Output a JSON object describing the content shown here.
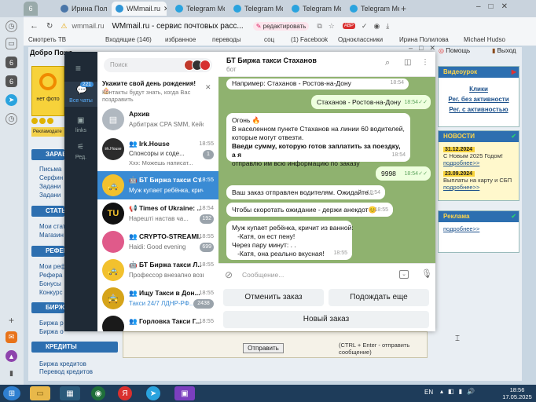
{
  "browser": {
    "tabs": [
      {
        "label": "6",
        "color": "#666"
      },
      {
        "label": "Ирина Поли",
        "color": "#4a76a8"
      },
      {
        "label": "WMmail.ru",
        "color": "#2f95d6"
      },
      {
        "label": "Telegram Me",
        "color": "#2aa3de"
      },
      {
        "label": "Telegram Me",
        "color": "#2aa3de"
      },
      {
        "label": "Telegram Me",
        "color": "#2aa3de"
      },
      {
        "label": "Telegram Me",
        "color": "#2aa3de"
      }
    ],
    "url": "wmmail.ru",
    "page_title": "WMmail.ru - сервис почтовых расс...",
    "edit_label": "редактировать",
    "bookmarks": [
      "Смотреть ТВ",
      "Входящие (146)",
      "избранное",
      "переводы",
      "соц",
      "(1) Facebook",
      "Одноклассники",
      "Ирина Полилова",
      "Michael Hudso"
    ],
    "extra_buttons": {
      "help": "Помощь",
      "exit": "Выход"
    }
  },
  "site": {
    "welcome": "Добро Пожа",
    "no_photo": "нет фото",
    "advert_text": "Рекламодате",
    "sections": [
      {
        "title": "ЗАРАБ",
        "links": [
          "Письма",
          "Серфин",
          "Задани",
          "Задани"
        ]
      },
      {
        "title": "СТАТЬ",
        "links": [
          "Мои стат",
          "Магазин"
        ]
      },
      {
        "title": "РЕФЕР",
        "links": [
          "Мои реф",
          "Рефера",
          "Бонусы",
          "Конкурс"
        ]
      },
      {
        "title": "БИРЖ",
        "links": [
          "Биржа р",
          "Биржа о"
        ]
      },
      {
        "title": "КРЕДИТЫ",
        "links": [
          "Биржа кредитов",
          "Перевод кредитов"
        ]
      }
    ],
    "right": {
      "video_title": "Видеоурок",
      "video_links": [
        "Клики",
        "Рег. без активности",
        "Рег. с активностью"
      ],
      "news_title": "НОВОСТИ",
      "news": [
        {
          "date": "31.12.2024",
          "text": "С Новым 2025 Годом!",
          "more": "подробнее>>"
        },
        {
          "date": "23.09.2024",
          "text": "Выплаты на карту и СБП",
          "more": "подробнее>>"
        }
      ],
      "ads_title": "Реклама",
      "ads_more": "подробнее>>"
    },
    "send_button": "Отправить",
    "send_hint": "(CTRL + Enter - отправить сообщение)"
  },
  "telegram": {
    "search_placeholder": "Поиск",
    "rail": [
      {
        "label": "Все чаты",
        "badge": "221"
      },
      {
        "label": "links",
        "badge": ""
      },
      {
        "label": "Ред.",
        "badge": ""
      }
    ],
    "birthday": {
      "title": "Укажите свой день рождения! 🎂",
      "text": "Контакты будут знать, когда Вас поздравить"
    },
    "chats": [
      {
        "name": "Архив",
        "preview": "Арбитраж CPA SMM, Кейсы ...",
        "time": "",
        "badge": "",
        "color": "#b0b8c0",
        "selected": false
      },
      {
        "name": "Irk.House",
        "preview": "Спонсоры и соде...",
        "preview2": "Ххх: Можешь написат...",
        "time": "18:55",
        "badge": "1",
        "color": "#2b2b2b",
        "selected": false
      },
      {
        "name": "БТ Биржа такси Ст...",
        "preview": "Муж купает ребёнка, крич...",
        "time": "18:55",
        "badge": "",
        "color": "#f2c12e",
        "selected": true
      },
      {
        "name": "Times of Ukraine: ...",
        "preview": "Нарешті настав ча...",
        "time": "18:54",
        "badge": "192",
        "color": "#111",
        "selected": false
      },
      {
        "name": "CRYPTO-STREAMI...",
        "preview": "Haidi: Good evening",
        "time": "18:55",
        "badge": "699",
        "color": "#e05a8a",
        "selected": false
      },
      {
        "name": "БТ Биржа такси Л...",
        "preview": "Профессор внезапно возвр...",
        "time": "18:55",
        "badge": "",
        "color": "#f2c12e",
        "selected": false
      },
      {
        "name": "Ищу Такси в Дон...",
        "preview": "Такси 24/7 ЛДНР-РФ...",
        "time": "18:55",
        "badge": "2438",
        "color": "#d6a41a",
        "selected": false
      },
      {
        "name": "Горловка Такси Г...",
        "preview": "",
        "time": "18:55",
        "badge": "",
        "color": "#1a1a1a",
        "selected": false
      }
    ],
    "header": {
      "title": "БТ Биржа такси Стаханов",
      "subtitle": "бот"
    },
    "messages": [
      {
        "text": "Например: Стаханов - Ростов-на-Дону",
        "time": "18:54",
        "out": false
      },
      {
        "text": "Стаханов - Ростов-на-Дону",
        "time": "18:54",
        "out": true
      },
      {
        "lines": [
          "Огонь 🔥",
          "В населенном пункте Стаханов на линии 60  водителей,",
          "которые могут отвезти.",
          "Введи сумму, которую готов заплатить за поездку, а я",
          "отправлю им всю информацию по заказу"
        ],
        "time": "18:54",
        "out": false
      },
      {
        "text": "9998",
        "time": "18:54",
        "out": true
      },
      {
        "text": "Ваш заказ отправлен водителям. Ожидайте...",
        "time": "18:54",
        "out": false
      },
      {
        "text": "Чтобы скоротать ожидание - держи анекдот😊",
        "time": "18:55",
        "out": false
      },
      {
        "lines": [
          "Муж купает ребёнка, кричит из ванной:",
          "   -Катя, он ест пену!",
          "Через пару минут: . .",
          "   -Катя, она реально вкусная!"
        ],
        "time": "18:55",
        "out": false
      }
    ],
    "input_placeholder": "Сообщение...",
    "keyboard": [
      "Отменить заказ",
      "Подождать еще",
      "Новый заказ"
    ]
  },
  "taskbar": {
    "lang": "EN",
    "time": "18:56",
    "date": "17.05.2025"
  }
}
